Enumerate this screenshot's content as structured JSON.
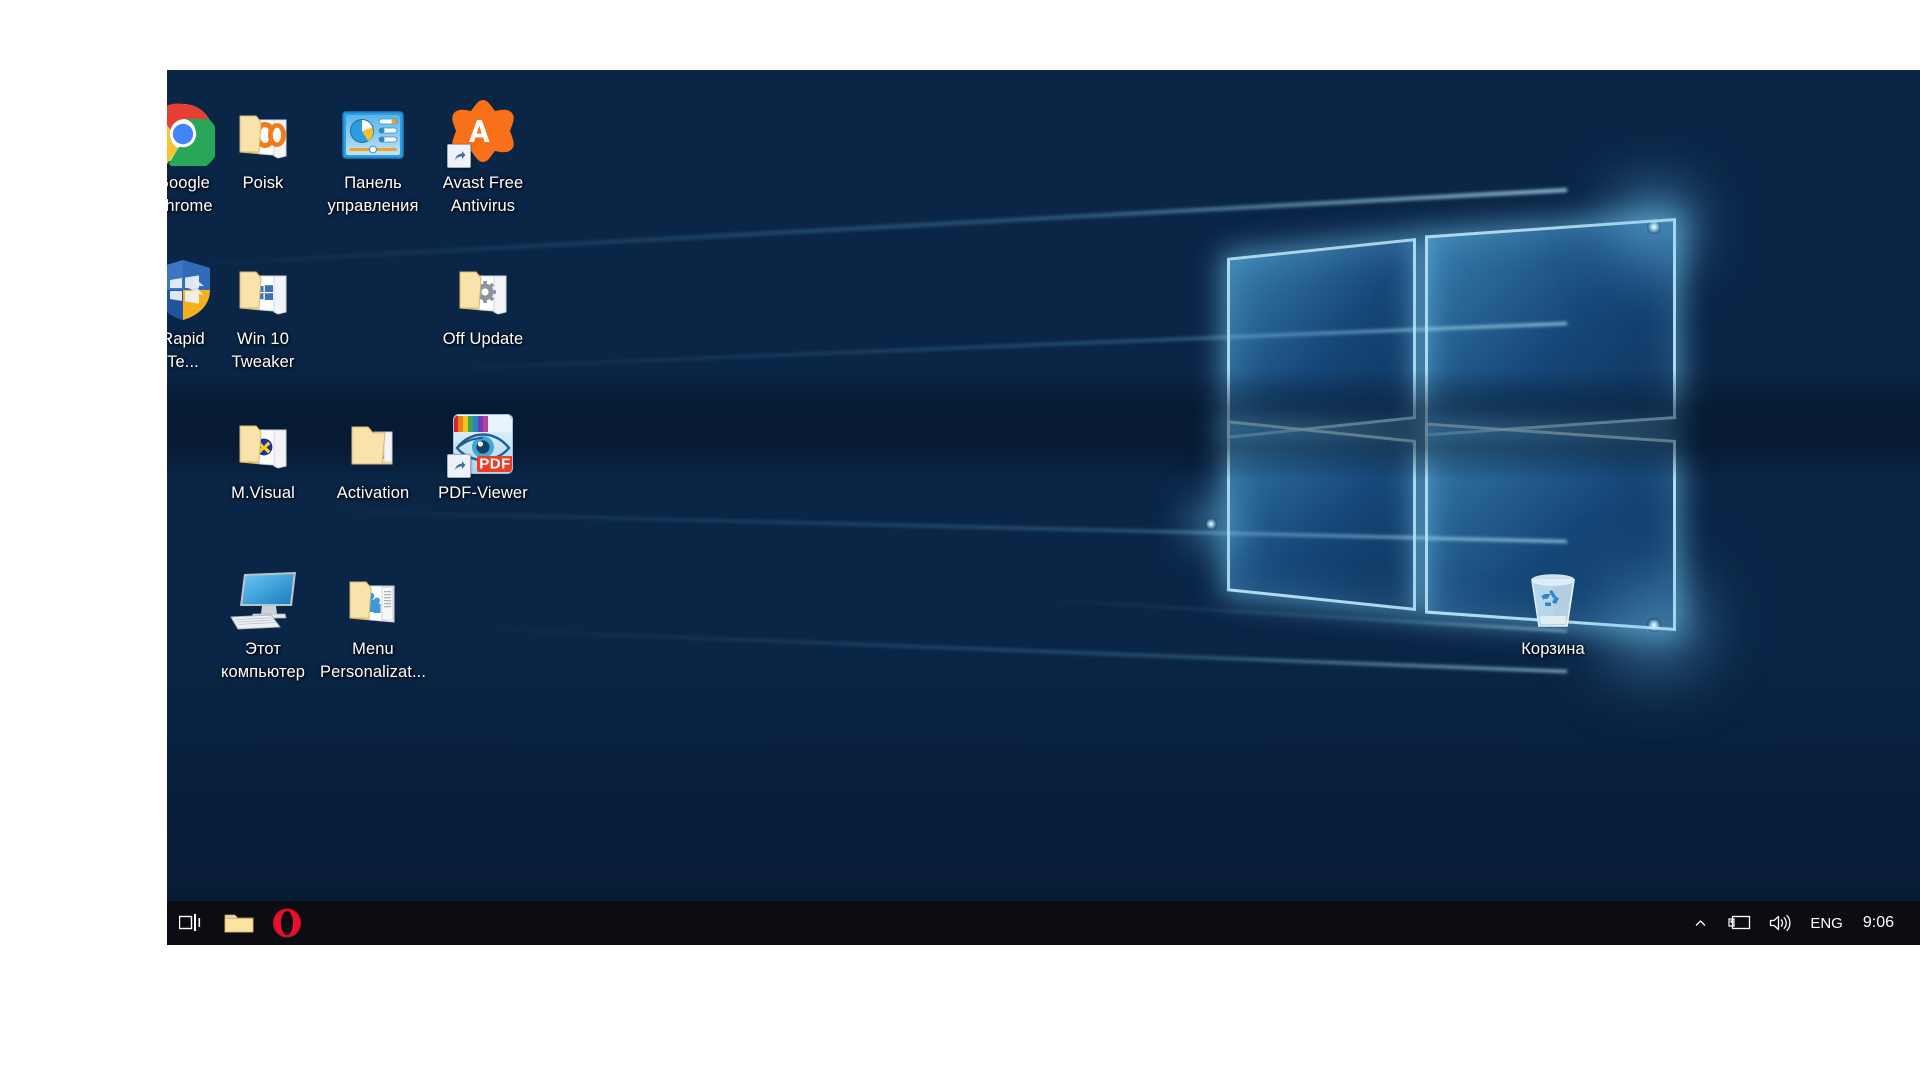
{
  "os": "Windows 10 Desktop",
  "desktop": {
    "background_name": "windows-10-hero-wallpaper",
    "accent_color": "#1e90d8",
    "icons": [
      {
        "name": "google-chrome",
        "label": "Google\nChrome",
        "icon": "chrome-icon",
        "shortcut": false,
        "col": 0,
        "row": 0,
        "clipped": true
      },
      {
        "name": "poisk",
        "label": "Poisk",
        "icon": "folder-opera-icon",
        "shortcut": false,
        "col": 1,
        "row": 0,
        "clipped": false
      },
      {
        "name": "control-panel",
        "label": "Панель\nуправления",
        "icon": "control-panel-icon",
        "shortcut": false,
        "col": 2,
        "row": 0,
        "clipped": false
      },
      {
        "name": "avast-free-antivirus",
        "label": "Avast Free\nAntivirus",
        "icon": "avast-icon",
        "shortcut": true,
        "col": 3,
        "row": 0,
        "clipped": false
      },
      {
        "name": "rapid-te",
        "label": "Rapid\nTe...",
        "icon": "shield-windows-icon",
        "shortcut": false,
        "col": 0,
        "row": 1,
        "clipped": true
      },
      {
        "name": "win-10-tweaker",
        "label": "Win 10\nTweaker",
        "icon": "folder-windows-icon",
        "shortcut": false,
        "col": 1,
        "row": 1,
        "clipped": false
      },
      {
        "name": "off-update",
        "label": "Off Update",
        "icon": "folder-gear-icon",
        "shortcut": false,
        "col": 3,
        "row": 1,
        "clipped": false
      },
      {
        "name": "m-visual",
        "label": "M.Visual",
        "icon": "folder-directx-icon",
        "shortcut": false,
        "col": 1,
        "row": 2,
        "clipped": false
      },
      {
        "name": "activation",
        "label": "Activation",
        "icon": "folder-docs-icon",
        "shortcut": false,
        "col": 2,
        "row": 2,
        "clipped": false
      },
      {
        "name": "pdf-viewer",
        "label": "PDF-Viewer",
        "icon": "pdf-viewer-icon",
        "shortcut": true,
        "col": 3,
        "row": 2,
        "clipped": false
      },
      {
        "name": "this-pc",
        "label": "Этот\nкомпьютер",
        "icon": "computer-icon",
        "shortcut": false,
        "col": 1,
        "row": 3,
        "clipped": false
      },
      {
        "name": "menu-personalization",
        "label": "Menu\nPersonalizat...",
        "icon": "folder-people-icon",
        "shortcut": false,
        "col": 2,
        "row": 3,
        "clipped": false
      }
    ],
    "recycle_bin": {
      "name": "recycle-bin",
      "label": "Корзина",
      "icon": "recycle-bin-icon"
    }
  },
  "taskbar": {
    "buttons": [
      {
        "name": "task-view",
        "label": "Task View",
        "icon": "task-view-icon"
      },
      {
        "name": "file-explorer",
        "label": "File Explorer",
        "icon": "folder-icon"
      },
      {
        "name": "opera-browser",
        "label": "Opera",
        "icon": "opera-icon"
      }
    ],
    "tray": [
      {
        "name": "show-hidden-icons",
        "label": "Show hidden icons",
        "icon": "chevron-up-icon"
      },
      {
        "name": "network",
        "label": "Network",
        "icon": "network-monitor-icon"
      },
      {
        "name": "volume",
        "label": "Volume",
        "icon": "speaker-icon"
      }
    ],
    "language": "ENG",
    "clock": {
      "time": "9:06"
    }
  }
}
